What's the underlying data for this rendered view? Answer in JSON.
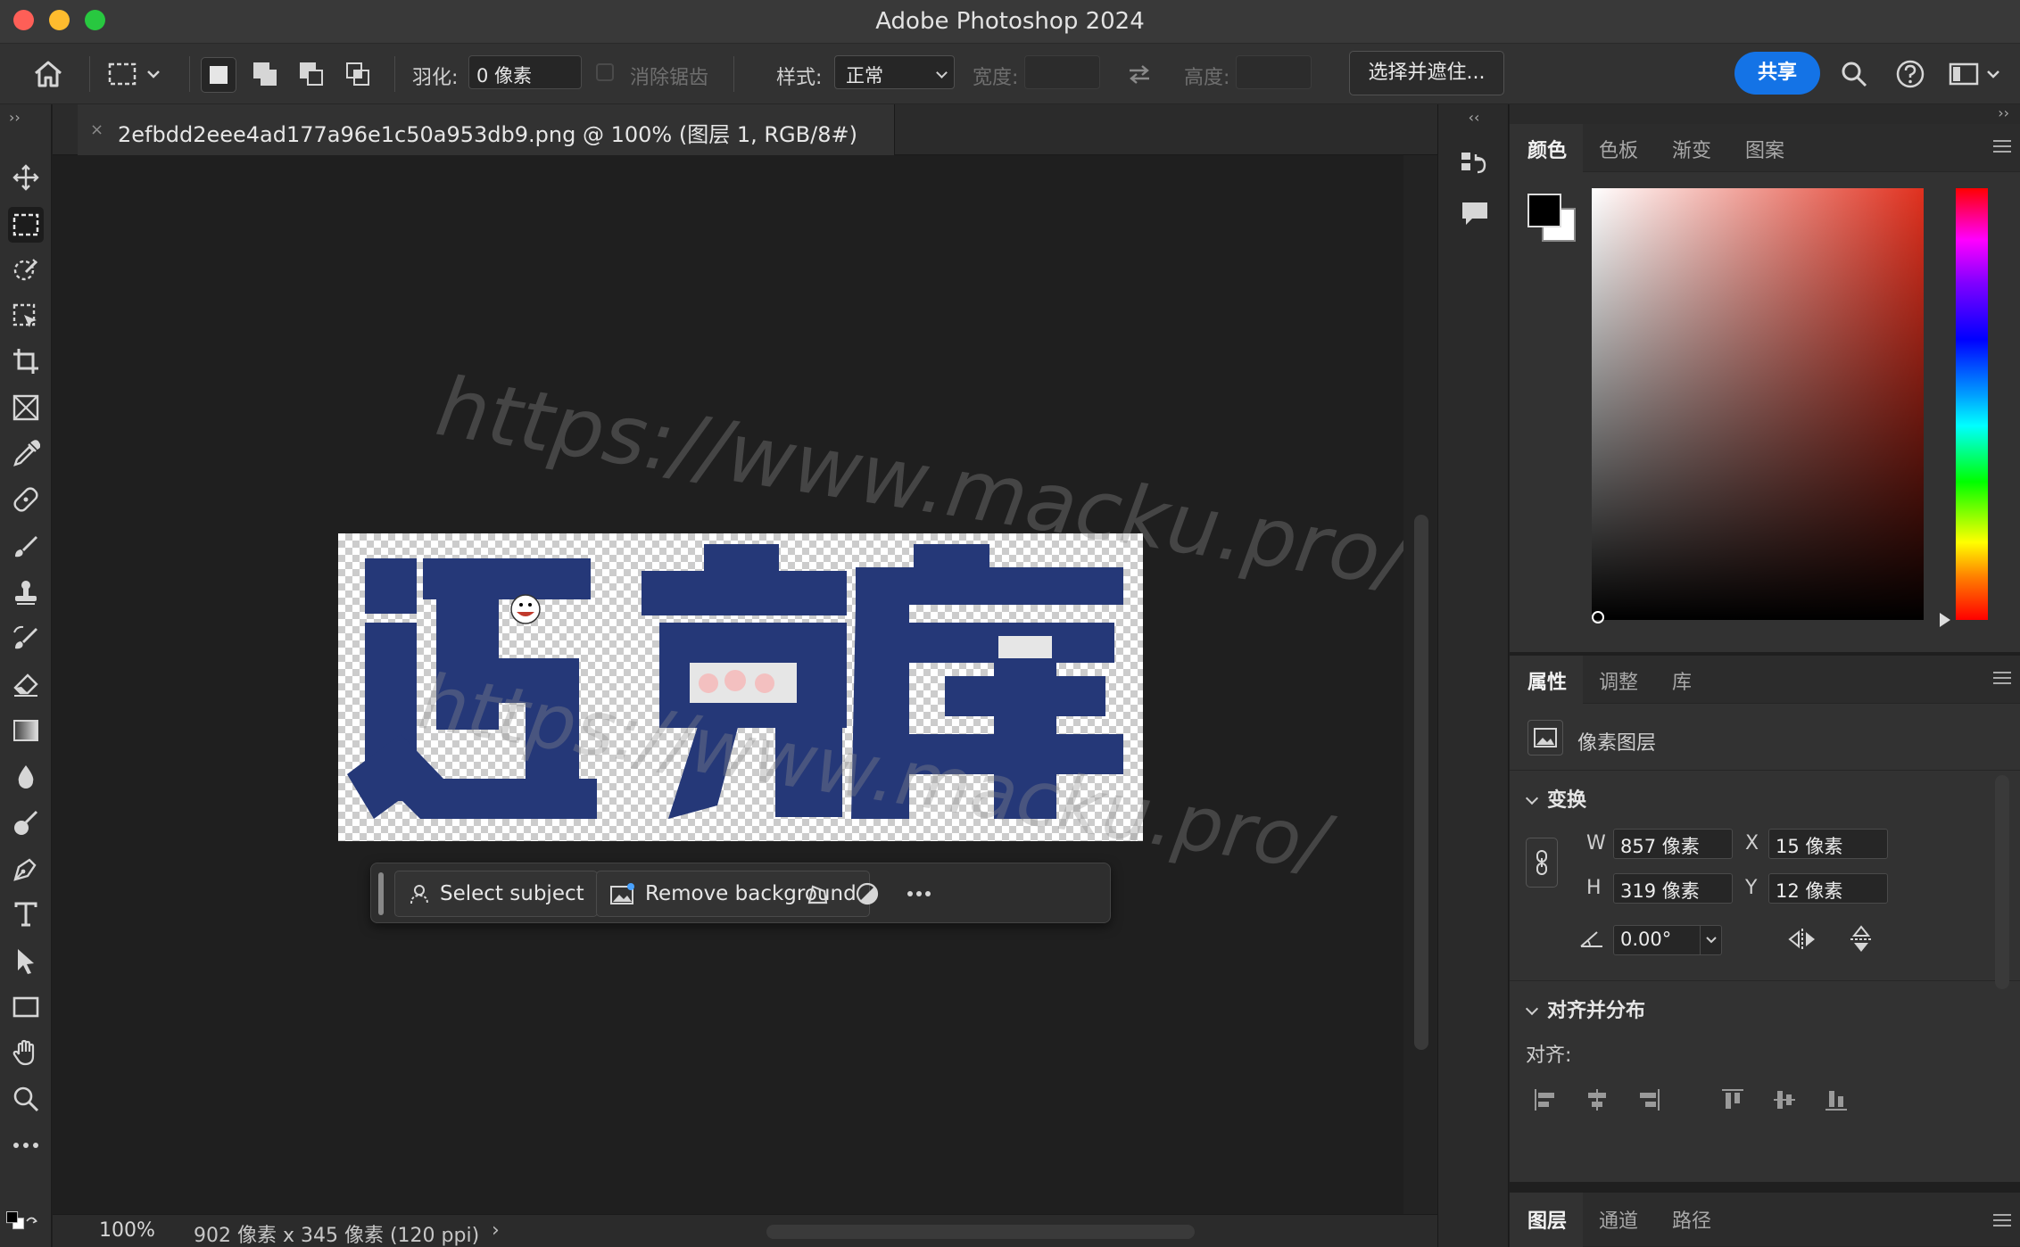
{
  "app": {
    "title": "Adobe Photoshop 2024"
  },
  "options_bar": {
    "feather_label": "羽化:",
    "feather_value": "0 像素",
    "antialias_label": "消除锯齿",
    "style_label": "样式:",
    "style_value": "正常",
    "width_label": "宽度:",
    "height_label": "高度:",
    "select_and_mask": "选择并遮住...",
    "share": "共享"
  },
  "document": {
    "tab_title": "2efbdd2eee4ad177a96e1c50a953db9.png @ 100% (图层 1, RGB/8#)",
    "zoom": "100%",
    "info": "902 像素 x 345 像素 (120 ppi)",
    "image_text": [
      "迈",
      "克",
      "库"
    ],
    "watermark": "https://www.macku.pro/",
    "text_color": "#253878"
  },
  "taskbar": {
    "select_subject": "Select subject",
    "remove_background": "Remove background"
  },
  "color_panel": {
    "tabs": [
      "颜色",
      "色板",
      "渐变",
      "图案"
    ],
    "active_tab": "颜色",
    "foreground": "#000000",
    "background": "#ffffff"
  },
  "properties_panel": {
    "tabs": [
      "属性",
      "调整",
      "库"
    ],
    "layer_type": "像素图层",
    "transform_title": "变换",
    "w_label": "W",
    "w_value": "857 像素",
    "h_label": "H",
    "h_value": "319 像素",
    "x_label": "X",
    "x_value": "15 像素",
    "y_label": "Y",
    "y_value": "12 像素",
    "angle_value": "0.00°",
    "align_title": "对齐并分布",
    "align_label": "对齐:"
  },
  "layers_panel": {
    "tabs": [
      "图层",
      "通道",
      "路径"
    ]
  }
}
